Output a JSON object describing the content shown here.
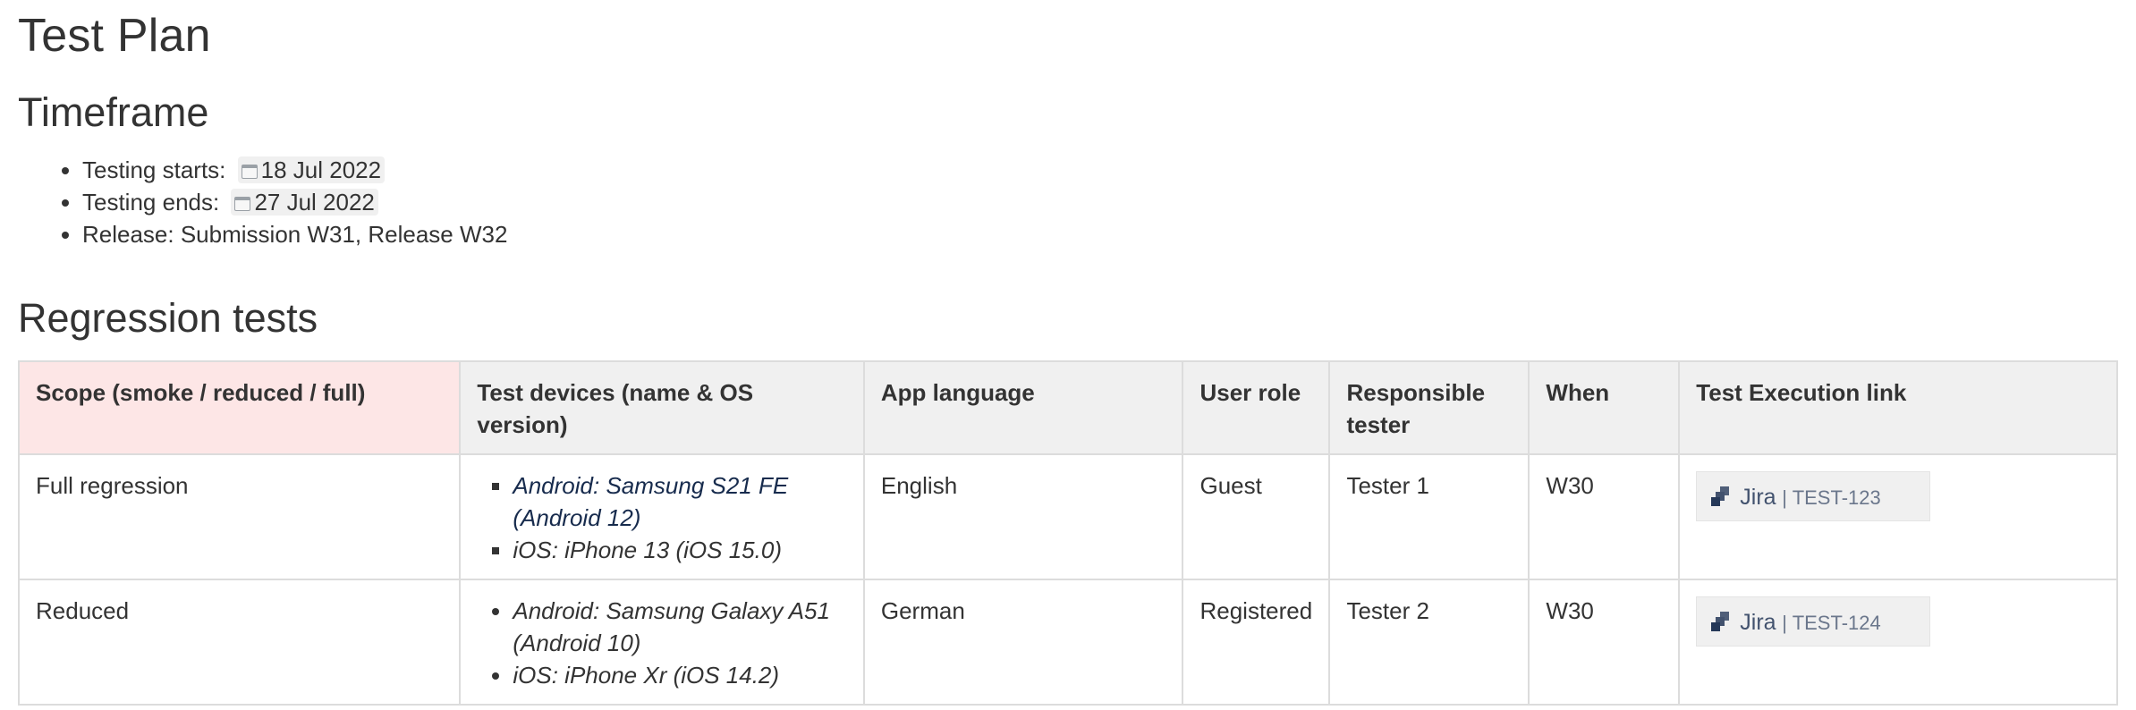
{
  "page": {
    "title": "Test Plan"
  },
  "timeframe": {
    "heading": "Timeframe",
    "items": [
      {
        "label": "Testing starts:",
        "date": "18 Jul 2022"
      },
      {
        "label": "Testing ends:",
        "date": "27 Jul 2022"
      },
      {
        "label": "Release: Submission W31, Release W32"
      }
    ]
  },
  "regression": {
    "heading": "Regression tests",
    "headers": [
      "Scope (smoke / reduced / full)",
      "Test devices (name & OS version)",
      "App language",
      "User role",
      "Responsible tester",
      "When",
      "Test Execution link"
    ],
    "rows": [
      {
        "scope": "Full regression",
        "devices": [
          "Android: Samsung S21 FE (Android 12)",
          "iOS: iPhone 13 (iOS 15.0)"
        ],
        "language": "English",
        "role": "Guest",
        "tester": "Tester 1",
        "when": "W30",
        "jira_label": "Jira",
        "jira_key": "| TEST-123"
      },
      {
        "scope": "Reduced",
        "devices": [
          "Android: Samsung Galaxy A51 (Android 10)",
          " iOS: iPhone Xr (iOS 14.2)"
        ],
        "language": "German",
        "role": "Registered",
        "tester": "Tester 2",
        "when": "W30",
        "jira_label": "Jira",
        "jira_key": "| TEST-124"
      }
    ]
  },
  "icons": {
    "date": "calendar-icon",
    "jira": "jira-icon"
  },
  "colors": {
    "scope_header_bg": "#fde6e6",
    "header_bg": "#f0f0f0",
    "text": "#333333",
    "link": "#172b4d"
  }
}
